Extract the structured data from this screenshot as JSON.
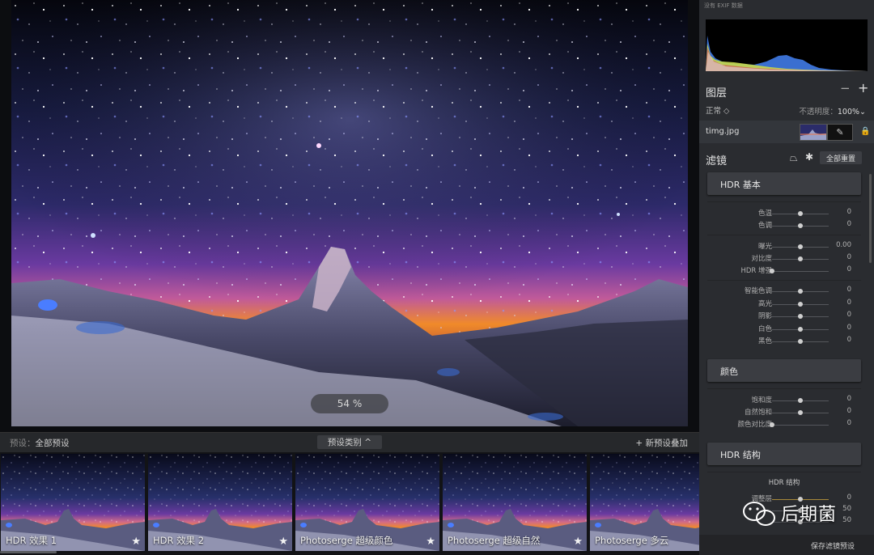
{
  "canvas": {
    "zoom_label": "54 %"
  },
  "preset_bar": {
    "label_prefix": "预设：",
    "label_value": "全部预设",
    "category_button": "预设类别 ^",
    "add_button": "+ 新预设叠加"
  },
  "thumbnails": [
    {
      "name": "HDR 效果 1",
      "star": "★"
    },
    {
      "name": "HDR 效果 2",
      "star": "★"
    },
    {
      "name": "Photoserge 超级颜色",
      "star": "★"
    },
    {
      "name": "Photoserge 超级自然",
      "star": "★"
    },
    {
      "name": "Photoserge 多云",
      "star": ""
    }
  ],
  "panel": {
    "exif_note": "没有 EXIF 数据",
    "layers": {
      "title": "图层",
      "minus": "−",
      "plus": "+",
      "blend_mode": "正常 ◇",
      "opacity_label": "不透明度：",
      "opacity_value": "100%⌄",
      "layer_name": "timg.jpg",
      "brush_icon": "✎",
      "lock_icon": "🔒"
    },
    "filters": {
      "title": "滤镜",
      "mask_icon": "⏢",
      "gear_icon": "✱",
      "reset_all": "全部重置"
    },
    "sections": [
      {
        "title": "HDR 基本"
      },
      {
        "title": "颜色"
      },
      {
        "title": "HDR 结构"
      }
    ],
    "hdr_basic": [
      [
        {
          "label": "色温",
          "value": "0",
          "pos": 0.5
        },
        {
          "label": "色调",
          "value": "0",
          "pos": 0.5
        }
      ],
      [
        {
          "label": "曝光",
          "value": "0.00",
          "pos": 0.5
        },
        {
          "label": "对比度",
          "value": "0",
          "pos": 0.5
        },
        {
          "label": "HDR 增强",
          "value": "0",
          "pos": 0.0
        }
      ],
      [
        {
          "label": "智能色调",
          "value": "0",
          "pos": 0.5
        },
        {
          "label": "高光",
          "value": "0",
          "pos": 0.5
        },
        {
          "label": "阴影",
          "value": "0",
          "pos": 0.5
        },
        {
          "label": "白色",
          "value": "0",
          "pos": 0.5
        },
        {
          "label": "黑色",
          "value": "0",
          "pos": 0.5
        }
      ]
    ],
    "color": [
      {
        "label": "饱和度",
        "value": "0",
        "pos": 0.5
      },
      {
        "label": "自然饱和",
        "value": "0",
        "pos": 0.5
      },
      {
        "label": "颜色对比度",
        "value": "0",
        "pos": 0.0
      }
    ],
    "hdr_structure": {
      "sub_title": "HDR 结构",
      "rows": [
        {
          "label": "调整层",
          "value": "0",
          "pos": 0.5
        },
        {
          "label": "",
          "value": "50",
          "pos": 0.5
        },
        {
          "label": "",
          "value": "50",
          "pos": 0.5
        }
      ]
    },
    "save_filter_preset": "保存滤镜预设"
  },
  "watermark": {
    "text": "后期菌"
  },
  "colors": {
    "panel_bg": "#2a2c30",
    "section_bg": "#3b3d42",
    "accent_orange": "#f08a2a",
    "sky_purple": "#6a3aa0"
  }
}
